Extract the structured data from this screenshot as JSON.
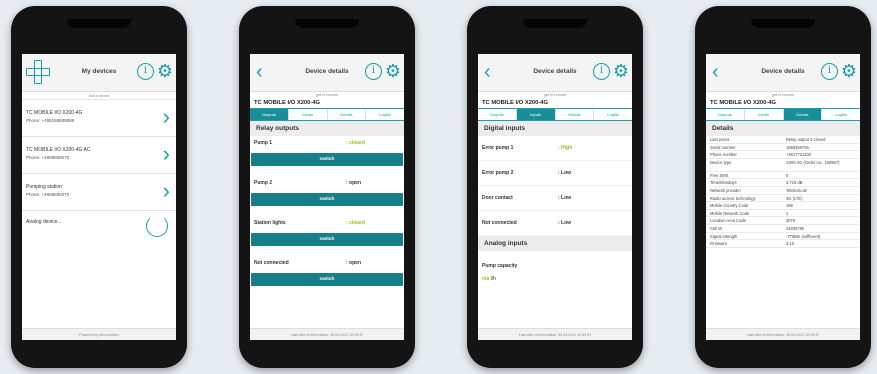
{
  "screen1": {
    "title": "My devices",
    "subtitle": "Add a device",
    "devices": [
      {
        "name": "TC MOBILE I/O X200-4G",
        "phone": "Phone: +495188888888"
      },
      {
        "name": "TC MOBILE I/O X200-4G AC",
        "phone": "Phone: +4988889570"
      },
      {
        "name": "Pumping station",
        "phone": "Phone: +4988880079"
      }
    ],
    "analog_label": "Analog device...",
    "footer": "Powered by tele-solution"
  },
  "screen2": {
    "title": "Device details",
    "subtitle": "get to remote",
    "device_name": "TC MOBILE I/O X200-4G",
    "tabs": [
      "Outputs",
      "Inputs",
      "Details",
      "Logfile"
    ],
    "section": "Relay outputs",
    "relays": [
      {
        "name": "Pump 1",
        "state": ": closed"
      },
      {
        "name": "Pump 2",
        "state": ": open"
      },
      {
        "name": "Station lights",
        "state": ": closed"
      },
      {
        "name": "Not connected",
        "state": ": open"
      }
    ],
    "switch_label": "switch",
    "footer": "Last date of information: 30.04.2021 12:03:37"
  },
  "screen3": {
    "title": "Device details",
    "subtitle": "get to remote",
    "device_name": "TC MOBILE I/O X200-4G",
    "tabs": [
      "Outputs",
      "Inputs",
      "Details",
      "Logfile"
    ],
    "digital_section": "Digital inputs",
    "inputs": [
      {
        "name": "Error pump 1",
        "state": ": High"
      },
      {
        "name": "Error pump 2",
        "state": ": Low"
      },
      {
        "name": "Door contact",
        "state": ": Low"
      },
      {
        "name": "Not connected",
        "state": ": Low"
      }
    ],
    "analog_section": "Analog inputs",
    "pump_capacity_label": "Pump capacity",
    "pump_capacity_value": "n/a",
    "pump_capacity_unit": "l/h",
    "footer": "Last date of information: 30.04.2021 12:03:37"
  },
  "screen4": {
    "title": "Device details",
    "subtitle": "get to remote",
    "device_name": "TC MOBILE I/O X200-4G",
    "tabs": [
      "Outputs",
      "Inputs",
      "Details",
      "Logfile"
    ],
    "section": "Details",
    "details": [
      {
        "key": "Last event",
        "value": "Relay output 3 closed"
      },
      {
        "key": "Serial number",
        "value": "1959259755"
      },
      {
        "key": "Phone number",
        "value": "+4917721108"
      },
      {
        "key": "Device type",
        "value": "X200-4G (Order no.: 100957)"
      },
      {
        "key": "Free SMS",
        "value": "0"
      },
      {
        "key": "Time/Mondays",
        "value": "3.719 dB"
      },
      {
        "key": "Network provider",
        "value": "Telekom.de"
      },
      {
        "key": "Radio access technology",
        "value": "4G (LTE)"
      },
      {
        "key": "Mobile Country Code",
        "value": "198"
      },
      {
        "key": "Mobile Network Code",
        "value": "1"
      },
      {
        "key": "Location Area Code",
        "value": "3070"
      },
      {
        "key": "Cell ID",
        "value": "2483679h"
      },
      {
        "key": "Signal strength",
        "value": "-77dBm (sufficient)"
      },
      {
        "key": "Firmware",
        "value": "3.10"
      }
    ],
    "footer": "Last date of information: 30.04.2021 12:03:37"
  },
  "colors": {
    "accent": "#1aa0a8",
    "button": "#177f8a",
    "closed": "#93c021"
  }
}
